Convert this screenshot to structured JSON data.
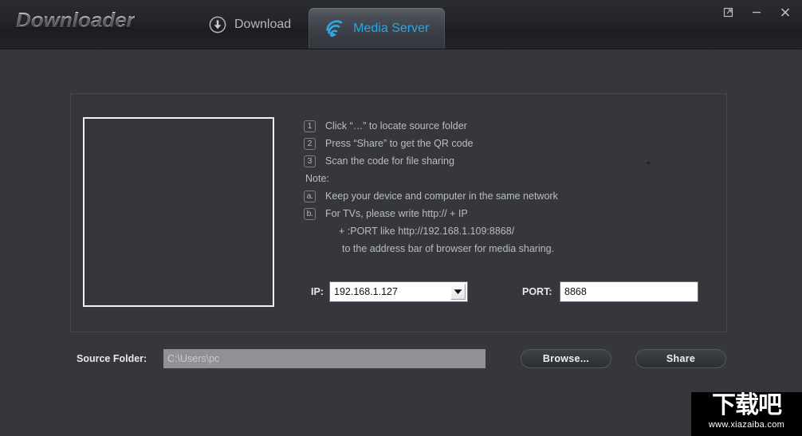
{
  "window": {
    "app_title": "Downloader",
    "controls": [
      {
        "name": "restore-window-button",
        "icon": "external-link-icon",
        "glyph": "↗"
      },
      {
        "name": "minimize-window-button",
        "icon": "minimize-icon",
        "glyph": "–"
      },
      {
        "name": "close-window-button",
        "icon": "close-icon",
        "glyph": "✕"
      }
    ]
  },
  "tabs": [
    {
      "id": "download",
      "label": "Download",
      "icon": "download-circle-icon",
      "active": false
    },
    {
      "id": "media-server",
      "label": "Media Server",
      "icon": "cast-icon",
      "active": true
    }
  ],
  "panel": {
    "qr_box": {
      "label": "QR code preview area",
      "content": ""
    },
    "steps": [
      {
        "badge": "1",
        "text": "Click “…” to locate source folder"
      },
      {
        "badge": "2",
        "text": "Press “Share” to get the QR code"
      },
      {
        "badge": "3",
        "text": "Scan the code for file sharing"
      }
    ],
    "note_label": "Note:",
    "notes": [
      {
        "badge": "a.",
        "text": "Keep your device and computer in the same network"
      },
      {
        "badge": "b.",
        "text": "For TVs, please write http:// + IP"
      }
    ],
    "note_continuation": [
      "+ :PORT like http://192.168.1.109:8868/",
      "to the address bar of browser for media sharing."
    ],
    "cursor_mark": "+"
  },
  "fields": {
    "ip_label": "IP:",
    "ip_value": "192.168.1.127",
    "ip_options": [
      "192.168.1.127"
    ],
    "port_label": "PORT:",
    "port_value": "8868",
    "port_placeholder": "",
    "source_label": "Source Folder:",
    "source_value": "C:\\Users\\pc",
    "source_placeholder": ""
  },
  "buttons": {
    "browse": "Browse...",
    "share": "Share"
  },
  "watermark": {
    "text_cn": "下载吧",
    "url": "www.xiazaiba.com"
  },
  "colors": {
    "accent": "#29a7e8",
    "body_bg": "#35373c",
    "titlebar_bg": "#232427",
    "text": "#b9bcc1",
    "label_text": "#e7e9ec"
  }
}
